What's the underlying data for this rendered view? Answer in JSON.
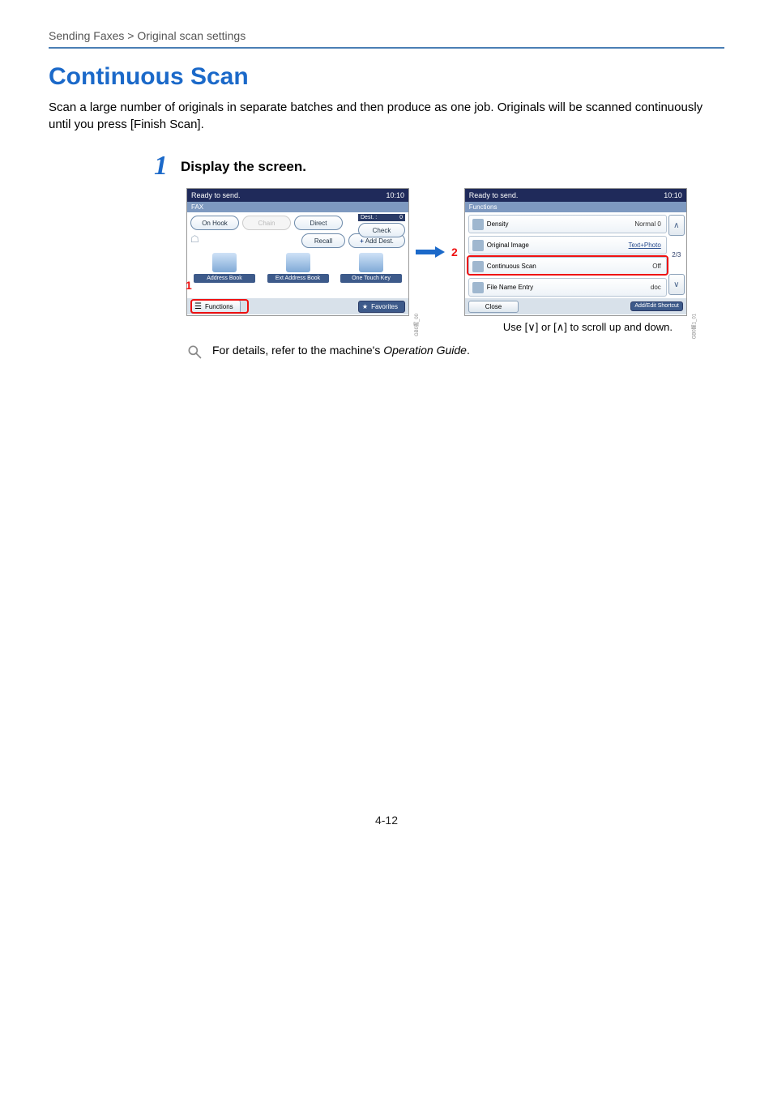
{
  "breadcrumb": "Sending Faxes > Original scan settings",
  "heading": "Continuous Scan",
  "intro": "Scan a large number of originals in separate batches and then produce as one job. Originals will be scanned continuously until you press [Finish Scan].",
  "step": {
    "number": "1",
    "title": "Display the screen."
  },
  "callouts": {
    "mark1": "1",
    "mark2": "2"
  },
  "panel1": {
    "status": "Ready to send.",
    "time": "10:10",
    "tab": "FAX",
    "dest_label": "Dest. :",
    "dest_count": "0",
    "on_hook": "On Hook",
    "chain": "Chain",
    "direct": "Direct",
    "check": "Check",
    "recall": "Recall",
    "add_dest": "Add Dest.",
    "address_book": "Address Book",
    "ext_address_book": "Ext Address Book",
    "one_touch_key": "One Touch Key",
    "functions": "Functions",
    "favorites": "Favorites",
    "side_code": "GB0握_00"
  },
  "panel2": {
    "status": "Ready to send.",
    "time": "10:10",
    "tab": "Functions",
    "items": [
      {
        "label": "Density",
        "value": "Normal 0",
        "plain": true
      },
      {
        "label": "Original Image",
        "value": "Text+Photo",
        "plain": false
      },
      {
        "label": "Continuous Scan",
        "value": "Off",
        "plain": true
      },
      {
        "label": "File Name Entry",
        "value": "doc",
        "plain": true
      }
    ],
    "page_indicator": "2/3",
    "close": "Close",
    "shortcut": "Add/Edit Shortcut",
    "side_code": "GB0握1_01"
  },
  "caption_prefix": "Use [",
  "caption_mid": "] or [",
  "caption_suffix": "] to scroll up and down.",
  "note_prefix": "For details, refer to the machine's ",
  "note_em": "Operation Guide",
  "note_suffix": ".",
  "page_number": "4-12"
}
